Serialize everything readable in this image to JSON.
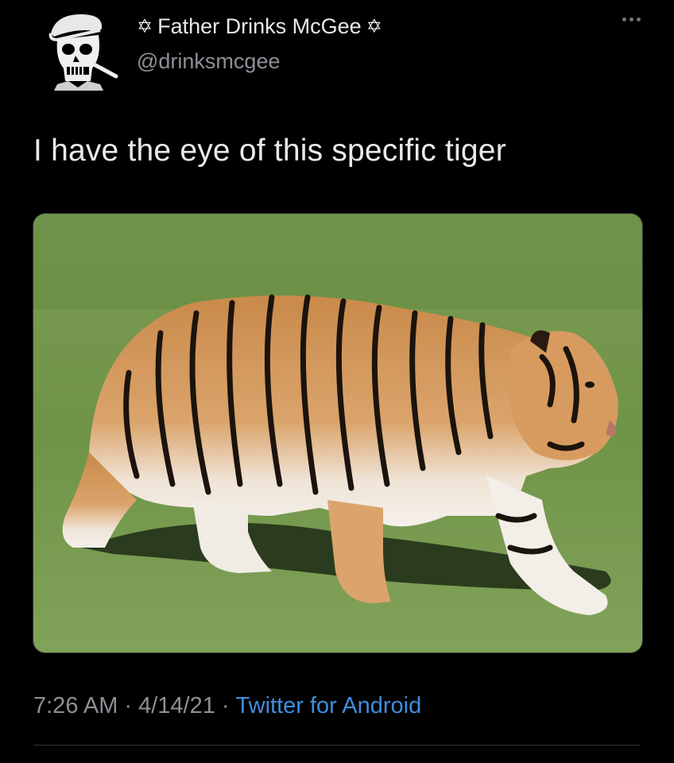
{
  "author": {
    "display_name": "Father Drinks McGee",
    "decoration_left": "✡",
    "decoration_right": "✡",
    "handle": "@drinksmcgee",
    "avatar_icon": "skull-with-cap-avatar-icon"
  },
  "more_menu_icon": "more-horizontal-icon",
  "tweet": {
    "text": "I have the eye of this specific tiger"
  },
  "media": {
    "subject": "photo"
  },
  "footer": {
    "time": "7:26 AM",
    "separator_1": "·",
    "date": "4/14/21",
    "separator_2": "·",
    "source": "Twitter for Android"
  },
  "colors": {
    "background": "#000000",
    "primary_text": "#e7e9ea",
    "secondary_text": "#8b9095",
    "link": "#3f8ddc"
  }
}
